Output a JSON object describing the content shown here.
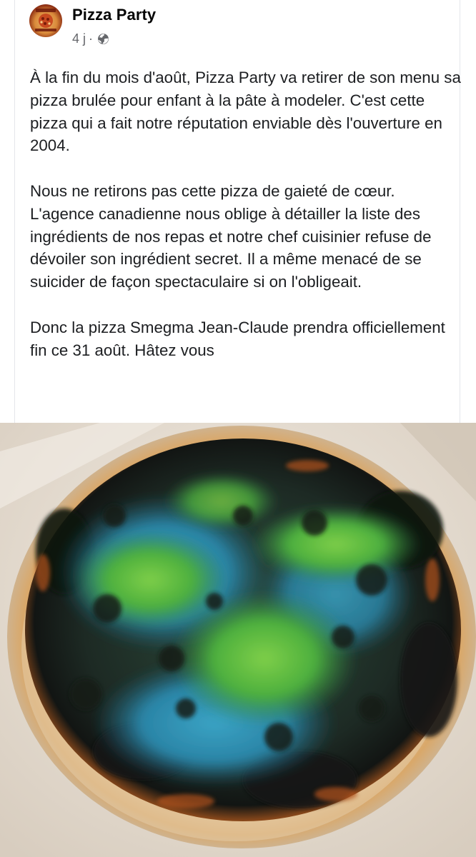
{
  "post": {
    "page_name": "Pizza Party",
    "timestamp": "4 j",
    "separator": "·",
    "visibility_icon": "globe-icon",
    "avatar_icon": "pizza-party-logo",
    "paragraphs": [
      "À la fin du mois d'août, Pizza Party va retirer de son menu sa pizza brulée pour enfant à la pâte à modeler. C'est cette pizza qui a fait notre réputation enviable dès l'ouverture en 2004.",
      "Nous ne retirons pas cette pizza de gaieté de cœur. L'agence canadienne nous oblige à détailler la liste des ingrédients de nos repas et notre chef cuisinier refuse de dévoiler son ingrédient secret. Il a même menacé de se suicider de façon spectaculaire si on l'obligeait.",
      "Donc la pizza Smegma Jean-Claude prendra officiellement fin ce 31 août. Hâtez vous"
    ],
    "photo": {
      "subject": "burnt-pizza-with-green-blue-play-dough",
      "colors": {
        "parchment": "#eae2d7",
        "crust": "#e9d3b4",
        "burnt": "#1f2420",
        "green": "#4fae3a",
        "blue": "#2d8fb0"
      }
    }
  }
}
